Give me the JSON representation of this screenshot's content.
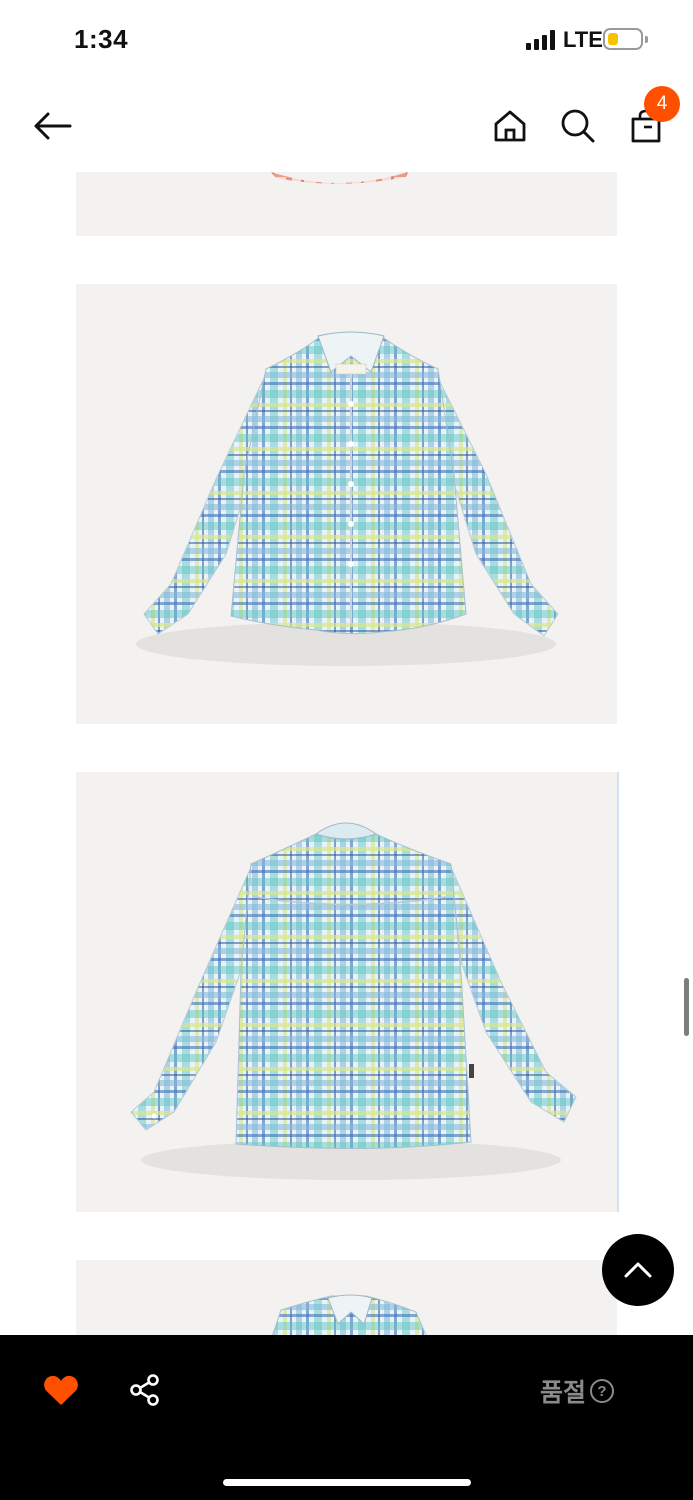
{
  "status_bar": {
    "time": "1:34",
    "network": "LTE",
    "battery_color": "#f5c400"
  },
  "header": {
    "icons": [
      "arrow-left-icon",
      "home-icon",
      "search-icon",
      "shopping-bag-icon"
    ],
    "cart_count": "4",
    "badge_color": "#ff5000"
  },
  "gallery": {
    "images": [
      {
        "subject": "red-plaid-shirt-hem"
      },
      {
        "subject": "blue-plaid-shirt-front"
      },
      {
        "subject": "blue-plaid-shirt-back"
      },
      {
        "subject": "blue-plaid-shirt-collar"
      }
    ]
  },
  "bottom_bar": {
    "soldout_label": "품절",
    "help_glyph": "?",
    "like_color": "#ff5000",
    "icons": [
      "heart-icon",
      "share-icon",
      "question-circle-icon"
    ]
  }
}
